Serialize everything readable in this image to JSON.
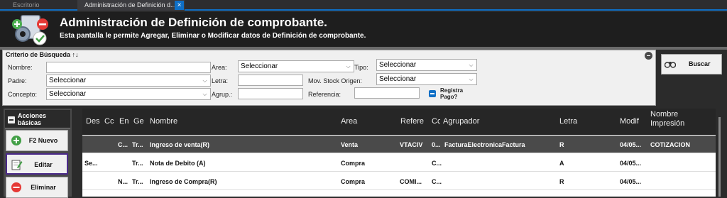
{
  "tabs": [
    {
      "label": "Escritorio"
    },
    {
      "label": "Administración de Definición d..."
    }
  ],
  "tab_close": "×",
  "header": {
    "title": "Administración de Definición de comprobante.",
    "subtitle": "Esta pantalla le permite Agregar, Eliminar o Modificar datos de Definición de comprobante."
  },
  "search": {
    "legend": "Criterio de Búsqueda ↑↓",
    "nombre_label": "Nombre:",
    "nombre_value": "",
    "padre_label": "Padre:",
    "padre_value": "Seleccionar",
    "concepto_label": "Concepto:",
    "concepto_value": "Seleccionar",
    "area_label": "Area:",
    "area_value": "Seleccionar",
    "letra_label": "Letra:",
    "letra_value": "",
    "agrup_label": "Agrup.:",
    "agrup_value": "",
    "tipo_label": "Tipo:",
    "tipo_value": "Seleccionar",
    "mov_label": "Mov. Stock Origen:",
    "mov_value": "Seleccionar",
    "ref_label": "Referencia:",
    "ref_value": "",
    "registra_label": "Registra Pago?",
    "buscar_label": "Buscar"
  },
  "actions": {
    "title": "Acciones básicas",
    "nuevo": "F2 Nuevo",
    "editar": "Editar",
    "eliminar": "Eliminar"
  },
  "grid": {
    "columns": [
      "Des",
      "Cc",
      "En",
      "Ge",
      "Nombre",
      "Area",
      "Refere",
      "Cc",
      "Agrupador",
      "Letra",
      "Modif",
      "Nombre Impresión"
    ],
    "rows": [
      [
        "",
        "C...",
        "Tr...",
        "",
        "Ingreso de venta(R)",
        "Venta",
        "VTACIV",
        "0...",
        "FacturaElectronicaFactura",
        "R",
        "04/05...",
        "COTIZACION"
      ],
      [
        "Se...",
        "",
        "Tr...",
        "",
        "Nota de Debito (A)",
        "Compra",
        "",
        "C...",
        "",
        "A",
        "04/05...",
        ""
      ],
      [
        "",
        "N...",
        "Tr...",
        "",
        "Ingreso de Compra(R)",
        "Compra",
        "COMI...",
        "C...",
        "",
        "R",
        "04/05...",
        ""
      ]
    ],
    "selected_row": 0
  }
}
